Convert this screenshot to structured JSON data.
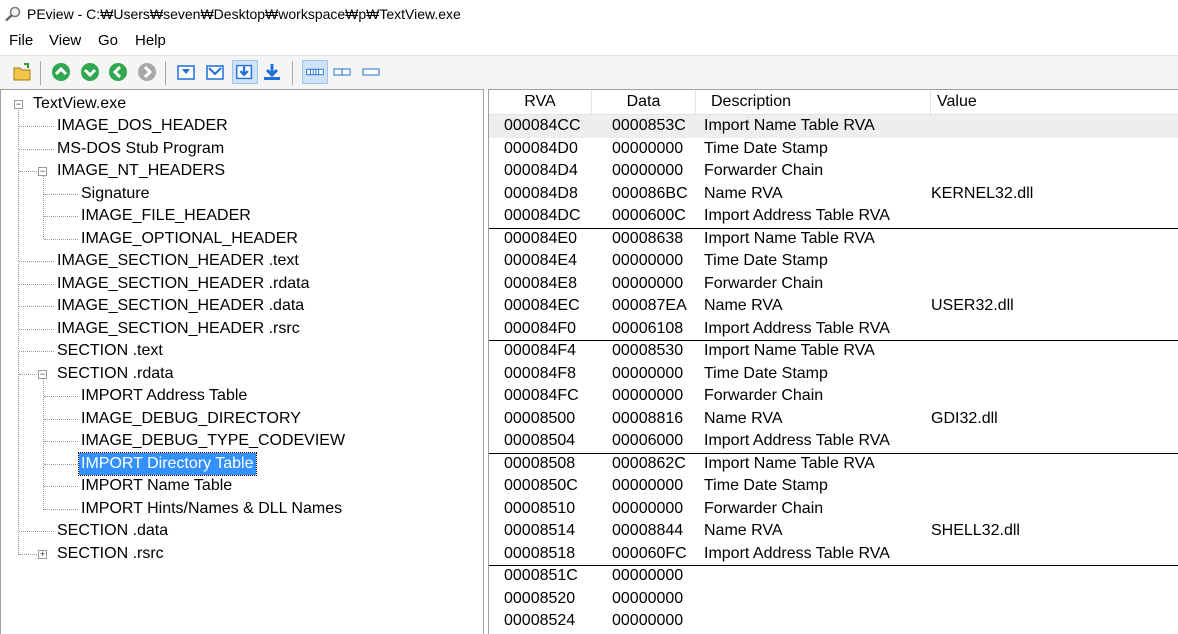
{
  "window": {
    "title": "PEview - C:₩Users₩seven₩Desktop₩workspace₩p₩TextView.exe",
    "icon": "magnifier-icon"
  },
  "menu": [
    "File",
    "View",
    "Go",
    "Help"
  ],
  "toolbar": {
    "buttons": [
      "open-file-icon",
      "go-up-icon",
      "go-down-icon",
      "back-icon",
      "forward-icon",
      "view-icon-1",
      "view-icon-2",
      "view-icon-3",
      "view-icon-4",
      "byte-view-icon",
      "word-view-icon",
      "dword-view-icon"
    ],
    "accent_green": "#2fa84f",
    "accent_blue": "#1e6fd9"
  },
  "tree": [
    {
      "label": "TextView.exe"
    },
    {
      "label": "IMAGE_DOS_HEADER"
    },
    {
      "label": "MS-DOS Stub Program"
    },
    {
      "label": "IMAGE_NT_HEADERS"
    },
    {
      "label": "Signature"
    },
    {
      "label": "IMAGE_FILE_HEADER"
    },
    {
      "label": "IMAGE_OPTIONAL_HEADER"
    },
    {
      "label": "IMAGE_SECTION_HEADER .text"
    },
    {
      "label": "IMAGE_SECTION_HEADER .rdata"
    },
    {
      "label": "IMAGE_SECTION_HEADER .data"
    },
    {
      "label": "IMAGE_SECTION_HEADER .rsrc"
    },
    {
      "label": "SECTION .text"
    },
    {
      "label": "SECTION .rdata"
    },
    {
      "label": "IMPORT Address Table"
    },
    {
      "label": "IMAGE_DEBUG_DIRECTORY"
    },
    {
      "label": "IMAGE_DEBUG_TYPE_CODEVIEW"
    },
    {
      "label": "IMPORT Directory Table",
      "selected": true
    },
    {
      "label": "IMPORT Name Table"
    },
    {
      "label": "IMPORT Hints/Names & DLL Names"
    },
    {
      "label": "SECTION .data"
    },
    {
      "label": "SECTION .rsrc"
    }
  ],
  "columns": [
    "RVA",
    "Data",
    "Description",
    "Value"
  ],
  "rows": [
    {
      "rva": "000084CC",
      "data": "0000853C",
      "description": "Import Name Table RVA",
      "value": ""
    },
    {
      "rva": "000084D0",
      "data": "00000000",
      "description": "Time Date Stamp",
      "value": ""
    },
    {
      "rva": "000084D4",
      "data": "00000000",
      "description": "Forwarder Chain",
      "value": ""
    },
    {
      "rva": "000084D8",
      "data": "000086BC",
      "description": "Name RVA",
      "value": "KERNEL32.dll"
    },
    {
      "rva": "000084DC",
      "data": "0000600C",
      "description": "Import Address Table RVA",
      "value": ""
    },
    {
      "rva": "000084E0",
      "data": "00008638",
      "description": "Import Name Table RVA",
      "value": ""
    },
    {
      "rva": "000084E4",
      "data": "00000000",
      "description": "Time Date Stamp",
      "value": ""
    },
    {
      "rva": "000084E8",
      "data": "00000000",
      "description": "Forwarder Chain",
      "value": ""
    },
    {
      "rva": "000084EC",
      "data": "000087EA",
      "description": "Name RVA",
      "value": "USER32.dll"
    },
    {
      "rva": "000084F0",
      "data": "00006108",
      "description": "Import Address Table RVA",
      "value": ""
    },
    {
      "rva": "000084F4",
      "data": "00008530",
      "description": "Import Name Table RVA",
      "value": ""
    },
    {
      "rva": "000084F8",
      "data": "00000000",
      "description": "Time Date Stamp",
      "value": ""
    },
    {
      "rva": "000084FC",
      "data": "00000000",
      "description": "Forwarder Chain",
      "value": ""
    },
    {
      "rva": "00008500",
      "data": "00008816",
      "description": "Name RVA",
      "value": "GDI32.dll"
    },
    {
      "rva": "00008504",
      "data": "00006000",
      "description": "Import Address Table RVA",
      "value": ""
    },
    {
      "rva": "00008508",
      "data": "0000862C",
      "description": "Import Name Table RVA",
      "value": ""
    },
    {
      "rva": "0000850C",
      "data": "00000000",
      "description": "Time Date Stamp",
      "value": ""
    },
    {
      "rva": "00008510",
      "data": "00000000",
      "description": "Forwarder Chain",
      "value": ""
    },
    {
      "rva": "00008514",
      "data": "00008844",
      "description": "Name RVA",
      "value": "SHELL32.dll"
    },
    {
      "rva": "00008518",
      "data": "000060FC",
      "description": "Import Address Table RVA",
      "value": ""
    },
    {
      "rva": "0000851C",
      "data": "00000000",
      "description": "",
      "value": ""
    },
    {
      "rva": "00008520",
      "data": "00000000",
      "description": "",
      "value": ""
    },
    {
      "rva": "00008524",
      "data": "00000000",
      "description": "",
      "value": ""
    }
  ]
}
